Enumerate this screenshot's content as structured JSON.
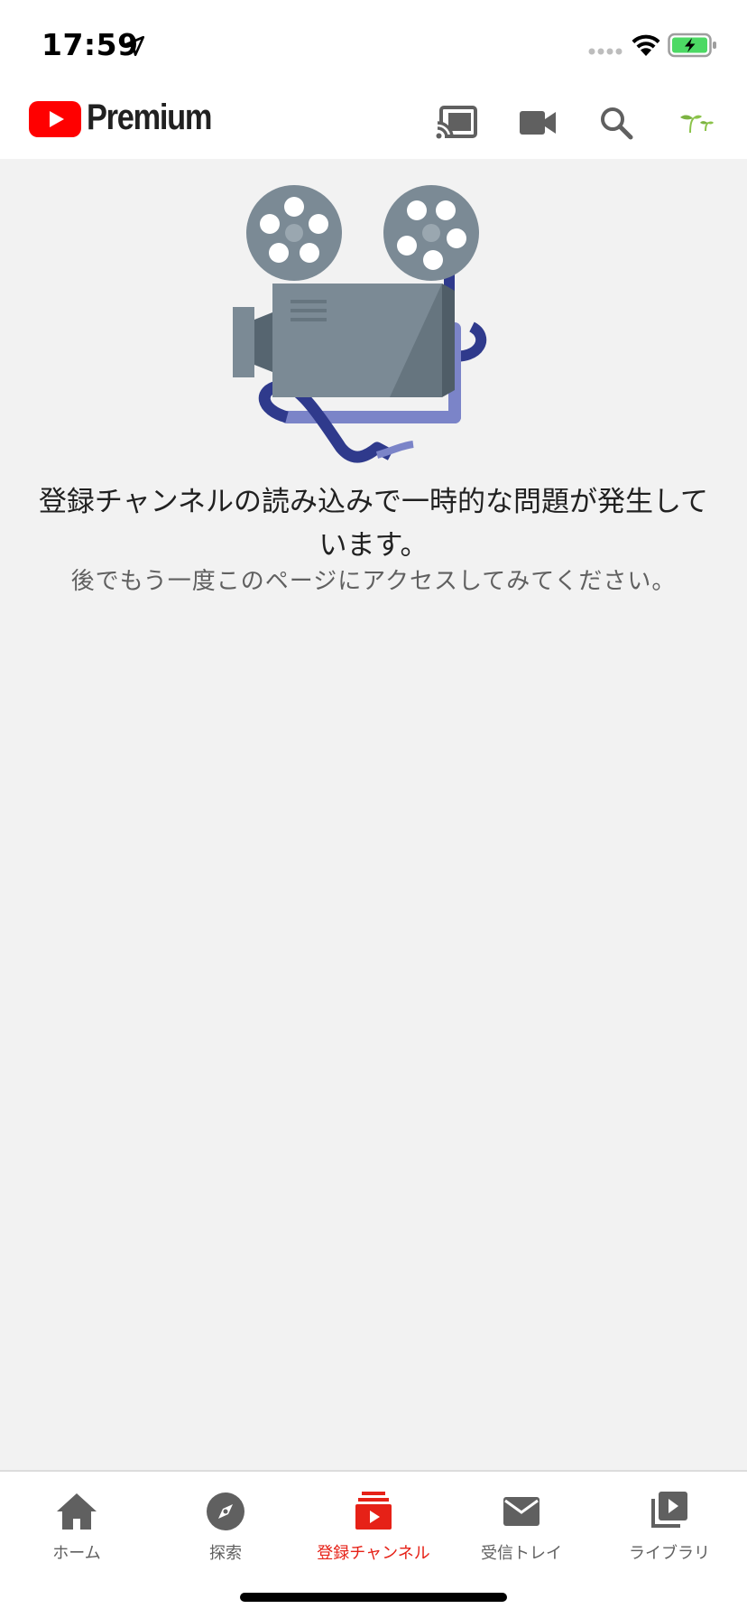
{
  "status_bar": {
    "time": "17:59"
  },
  "header": {
    "brand": "Premium",
    "icons": [
      "cast-icon",
      "video-camera-icon",
      "search-icon",
      "account-sprout-icon"
    ]
  },
  "error": {
    "title": "登録チャンネルの読み込みで一時的な問題が発生しています。",
    "subtitle": "後でもう一度このページにアクセスしてみてください。"
  },
  "bottom_nav": {
    "items": [
      {
        "label": "ホーム",
        "icon": "home-icon"
      },
      {
        "label": "探索",
        "icon": "compass-icon"
      },
      {
        "label": "登録チャンネル",
        "icon": "subscriptions-icon",
        "active": true
      },
      {
        "label": "受信トレイ",
        "icon": "mail-icon"
      },
      {
        "label": "ライブラリ",
        "icon": "library-icon"
      }
    ]
  },
  "colors": {
    "accent": "#e62117",
    "youtube_red": "#ff0000",
    "icon_gray": "#606060",
    "background": "#f2f2f2",
    "film_dark": "#2f3a8c",
    "film_light": "#7b84c8",
    "projector_gray": "#7b8a95"
  }
}
